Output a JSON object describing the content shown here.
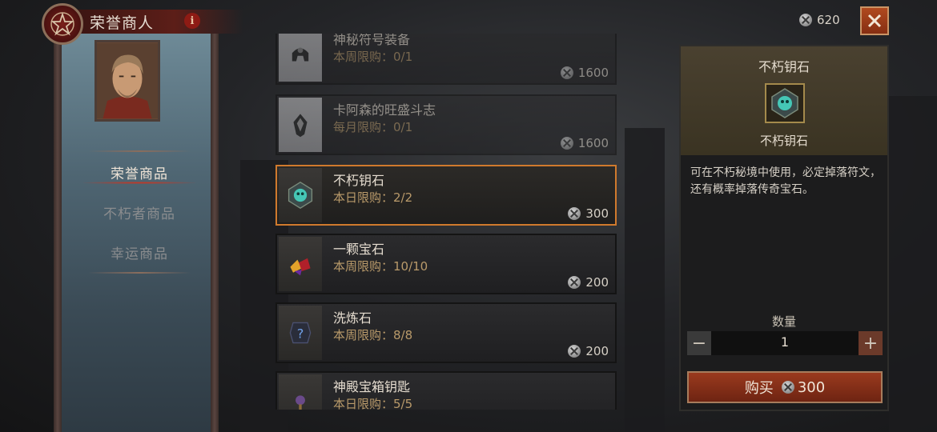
{
  "header": {
    "title": "荣誉商人",
    "info_glyph": "i",
    "currency_amount": "620",
    "close_icon": "close-icon"
  },
  "sidebar": {
    "items": [
      {
        "label": "荣誉商品",
        "active": true
      },
      {
        "label": "不朽者商品",
        "active": false
      },
      {
        "label": "幸运商品",
        "active": false
      }
    ]
  },
  "items": [
    {
      "name": "神秘符号装备",
      "limit": "本周限购：0/1",
      "price": "1600",
      "icon": "helmet-icon",
      "state": "faded"
    },
    {
      "name": "卡阿森的旺盛斗志",
      "limit": "每月限购：0/1",
      "price": "1600",
      "icon": "crest-icon",
      "state": "faded"
    },
    {
      "name": "不朽钥石",
      "limit": "本日限购：2/2",
      "price": "300",
      "icon": "key-stone-icon",
      "state": "selected"
    },
    {
      "name": "一颗宝石",
      "limit": "本周限购：10/10",
      "price": "200",
      "icon": "gem-icon",
      "state": "normal"
    },
    {
      "name": "洗炼石",
      "limit": "本周限购：8/8",
      "price": "200",
      "icon": "reforge-stone-icon",
      "state": "normal"
    },
    {
      "name": "神殿宝箱钥匙",
      "limit": "本日限购：5/5",
      "price": "",
      "icon": "chest-key-icon",
      "state": "normal"
    }
  ],
  "detail": {
    "title": "不朽钥石",
    "icon_name": "不朽钥石",
    "description": "可在不朽秘境中使用，必定掉落符文，还有概率掉落传奇宝石。",
    "quantity_label": "数量",
    "quantity": "1",
    "buy_label": "购买",
    "buy_price": "300"
  },
  "colors": {
    "accent_selected": "#d07a2d",
    "buy_button": "#9a3a1e",
    "limit_text": "#b99a6a"
  }
}
